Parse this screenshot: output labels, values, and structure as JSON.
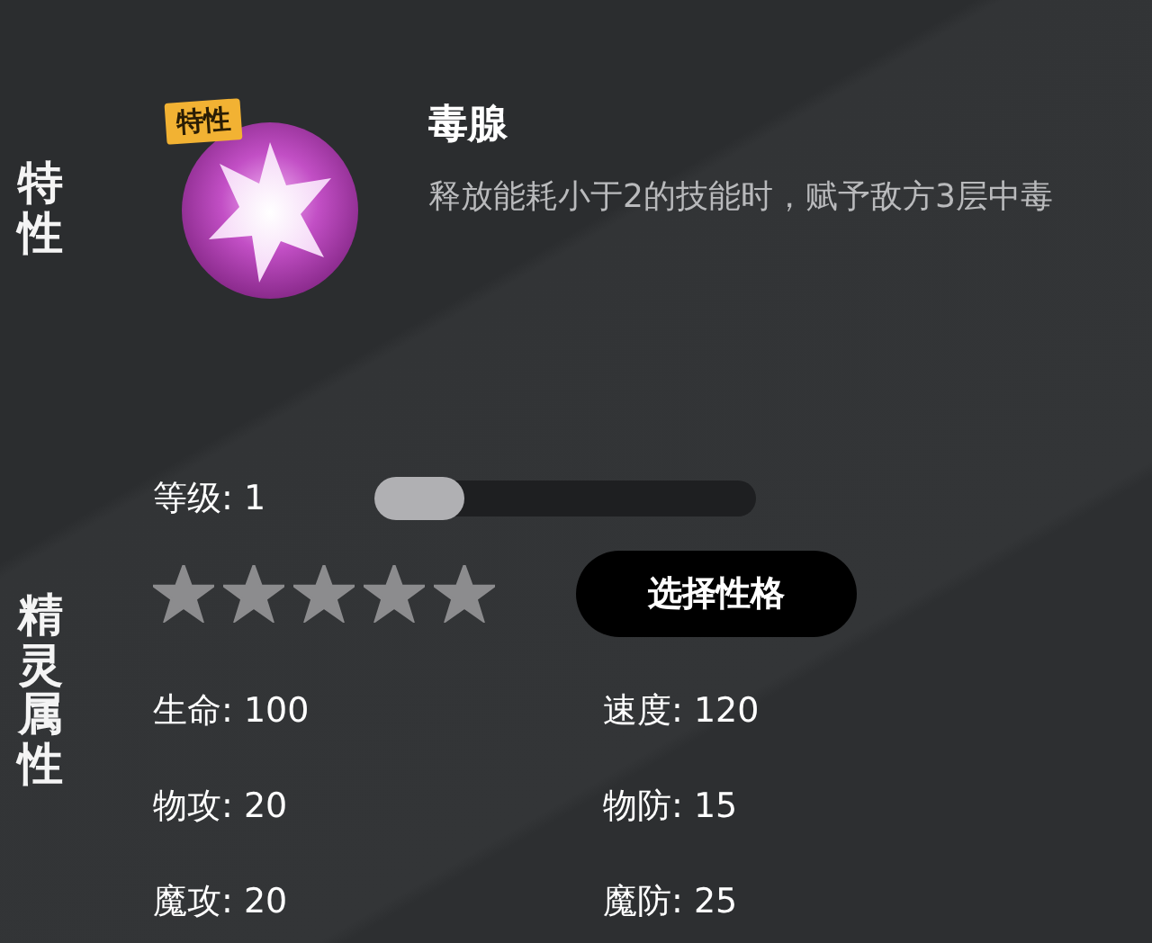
{
  "trait_section": {
    "label": "特性",
    "badge": "特性",
    "name": "毒腺",
    "description": "释放能耗小于2的技能时，赋予敌方3层中毒"
  },
  "attributes_section": {
    "label": "精灵属性",
    "level": {
      "label": "等级: 1",
      "level": 0
    },
    "rating": {
      "stars": 5
    },
    "nature_button": "选择性格",
    "stats": [
      {
        "label": "生命: 100"
      },
      {
        "label": "速度: 120"
      },
      {
        "label": "物攻: 20"
      },
      {
        "label": "物防: 15"
      },
      {
        "label": "魔攻: 20"
      },
      {
        "label": "魔防: 25"
      }
    ]
  }
}
